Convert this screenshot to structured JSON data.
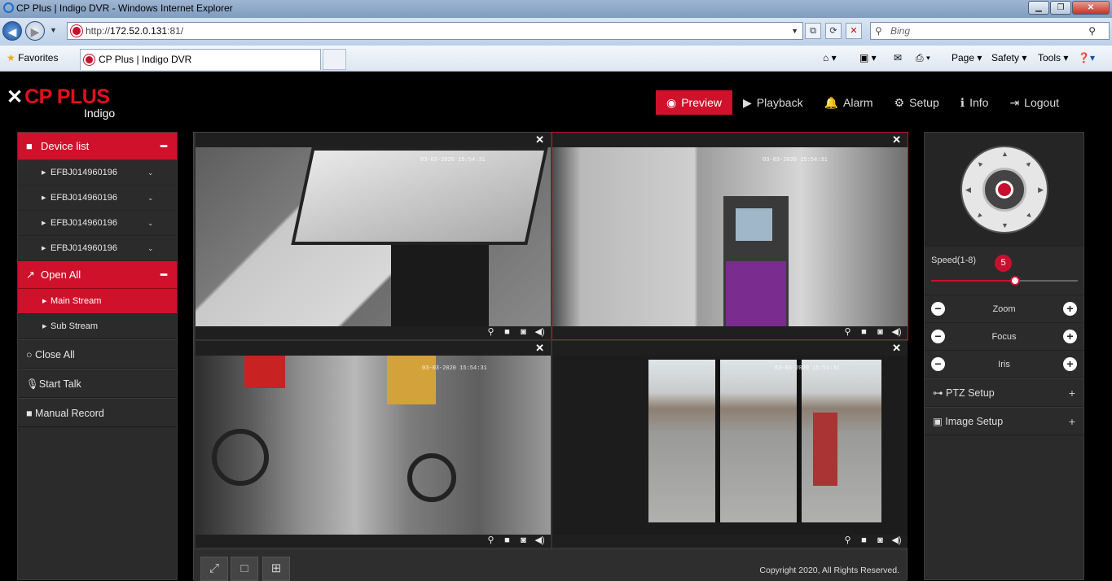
{
  "window": {
    "title": "CP Plus | Indigo DVR - Windows Internet Explorer"
  },
  "browser": {
    "url_scheme": "http://",
    "url_host": "172.52.0.131",
    "url_rest": ":81/",
    "search_placeholder": "Bing",
    "favorites_label": "Favorites",
    "tab_title": "CP Plus | Indigo DVR",
    "commands": [
      "Page",
      "Safety",
      "Tools"
    ]
  },
  "app": {
    "brand": "CP PLUS",
    "product": "Indigo",
    "nav": [
      {
        "label": "Preview",
        "icon": "eye-icon"
      },
      {
        "label": "Playback",
        "icon": "play-icon"
      },
      {
        "label": "Alarm",
        "icon": "bell-icon"
      },
      {
        "label": "Setup",
        "icon": "gear-icon"
      },
      {
        "label": "Info",
        "icon": "info-icon"
      },
      {
        "label": "Logout",
        "icon": "logout-icon"
      }
    ]
  },
  "sidebar": {
    "device_list_label": "Device list",
    "devices": [
      "EFBJ014960196",
      "EFBJ014960196",
      "EFBJ014960196",
      "EFBJ014960196"
    ],
    "open_all_label": "Open All",
    "streams": [
      "Main Stream",
      "Sub Stream"
    ],
    "close_all_label": "Close All",
    "start_talk_label": "Start Talk",
    "manual_record_label": "Manual Record"
  },
  "video": {
    "timestamps": [
      "03-03-2020 15:54:31",
      "03-03-2020 15:54:31",
      "03-03-2020 15:54:31",
      "03-03-2020 15:54:31"
    ],
    "copyright": "Copyright 2020, All Rights Reserved."
  },
  "ptz": {
    "speed_label": "Speed(1-8)",
    "speed_value": "5",
    "speed_fraction": 0.57,
    "zoom_label": "Zoom",
    "focus_label": "Focus",
    "iris_label": "Iris",
    "ptz_setup_label": "PTZ Setup",
    "image_setup_label": "Image Setup"
  },
  "colors": {
    "accent": "#d0112b",
    "panel": "#2b2b2b"
  }
}
